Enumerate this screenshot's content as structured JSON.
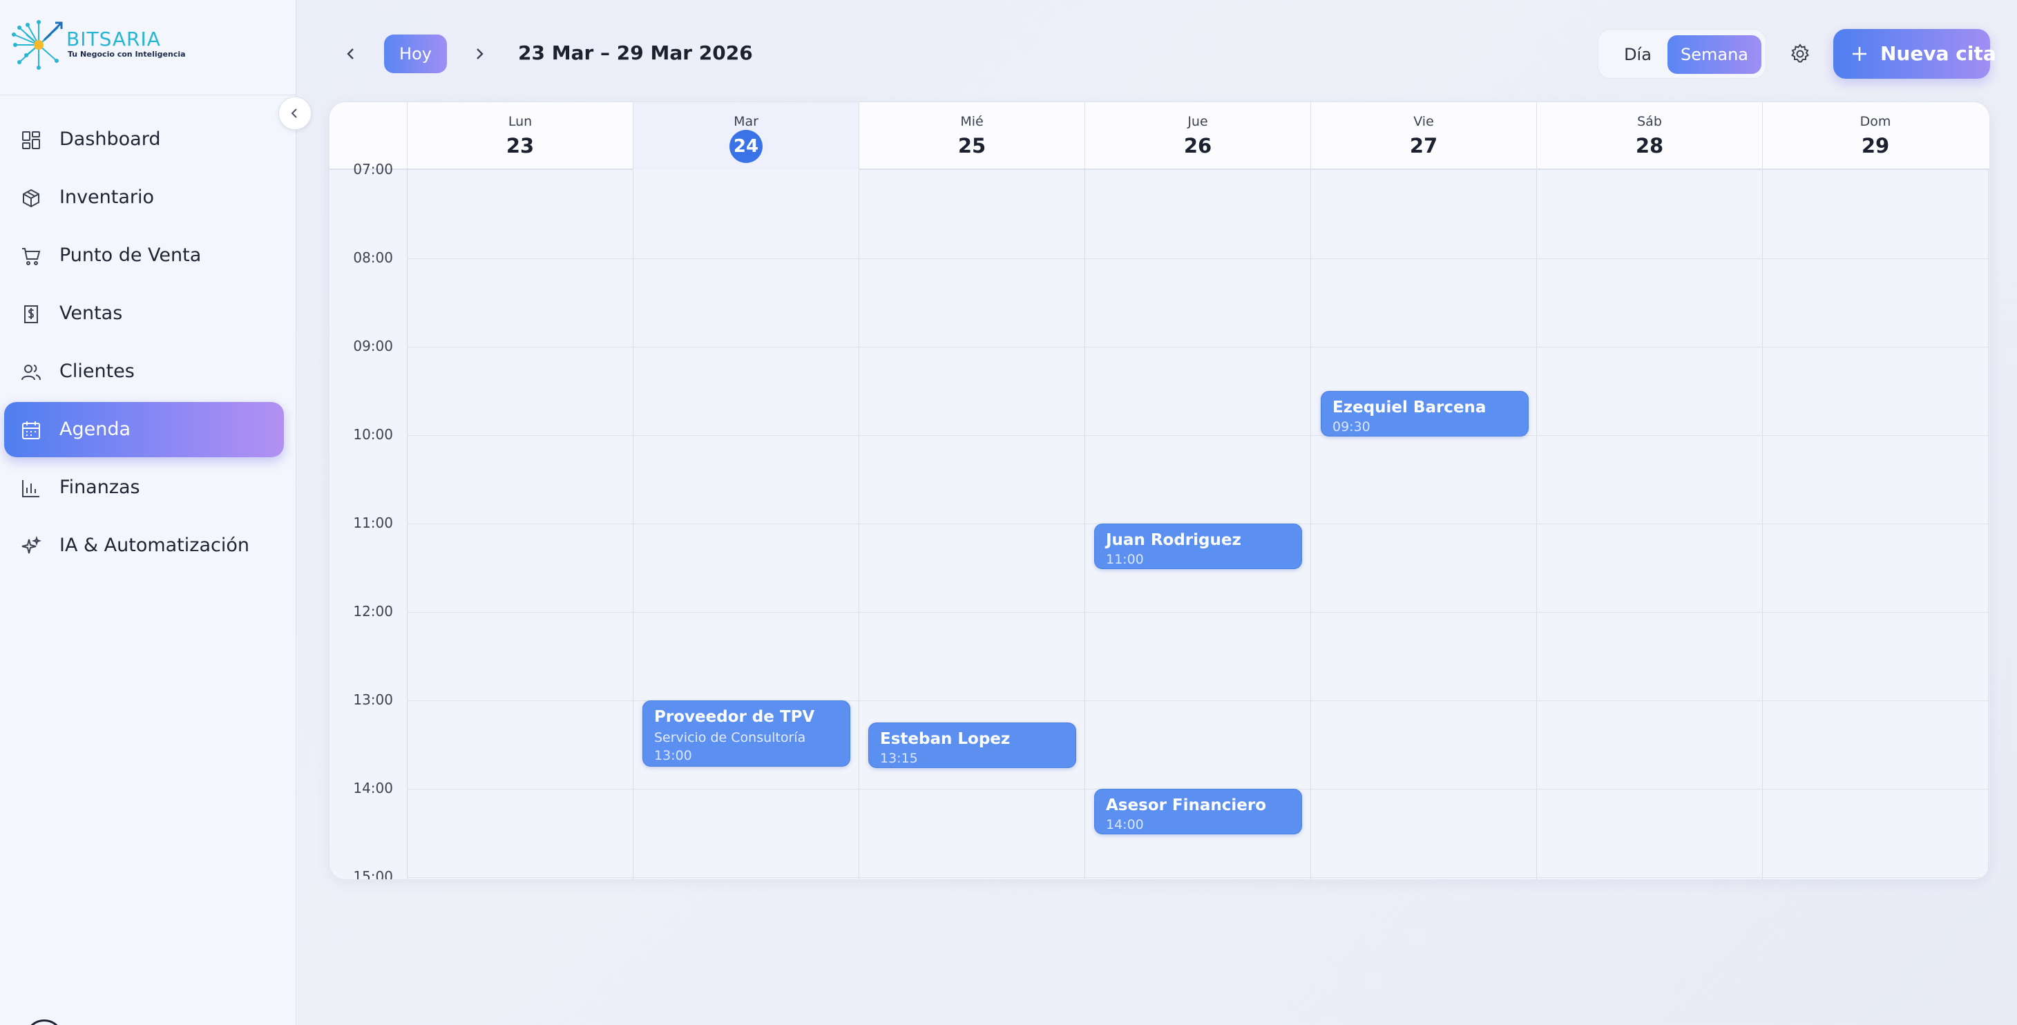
{
  "brand": {
    "name": "BITSARIA",
    "tagline": "Tu Negocio con Inteligencia",
    "color": "#27b5d3"
  },
  "sidebar": {
    "items": [
      {
        "label": "Dashboard",
        "icon": "dashboard-icon"
      },
      {
        "label": "Inventario",
        "icon": "package-icon"
      },
      {
        "label": "Punto de Venta",
        "icon": "cart-icon"
      },
      {
        "label": "Ventas",
        "icon": "receipt-dollar-icon"
      },
      {
        "label": "Clientes",
        "icon": "users-icon"
      },
      {
        "label": "Agenda",
        "icon": "calendar-icon",
        "active": true
      },
      {
        "label": "Finanzas",
        "icon": "bar-chart-icon"
      },
      {
        "label": "IA & Automatización",
        "icon": "sparkles-icon"
      }
    ]
  },
  "toolbar": {
    "today_label": "Hoy",
    "date_range": "23 Mar – 29 Mar 2026",
    "view_day": "Día",
    "view_week": "Semana",
    "active_view": "Semana",
    "new_label": "Nueva cita"
  },
  "calendar": {
    "days": [
      {
        "name": "Lun",
        "num": "23"
      },
      {
        "name": "Mar",
        "num": "24",
        "today": true
      },
      {
        "name": "Mié",
        "num": "25"
      },
      {
        "name": "Jue",
        "num": "26"
      },
      {
        "name": "Vie",
        "num": "27"
      },
      {
        "name": "Sáb",
        "num": "28"
      },
      {
        "name": "Dom",
        "num": "29"
      }
    ],
    "hours": [
      "07:00",
      "08:00",
      "09:00",
      "10:00",
      "11:00",
      "12:00",
      "13:00",
      "14:00",
      "15:00"
    ],
    "events": [
      {
        "title": "Ezequiel Barcena",
        "time": "09:30",
        "day": "Vie"
      },
      {
        "title": "Juan Rodriguez",
        "time": "11:00",
        "day": "Jue"
      },
      {
        "title": "Proveedor de TPV",
        "subtitle": "Servicio de Consultoría",
        "time": "13:00",
        "day": "Mar"
      },
      {
        "title": "Esteban Lopez",
        "time": "13:15",
        "day": "Mié"
      },
      {
        "title": "Asesor Financiero",
        "time": "14:00",
        "day": "Jue"
      }
    ],
    "accent": "#3a73e8",
    "event_color": "#5b8ff0"
  }
}
